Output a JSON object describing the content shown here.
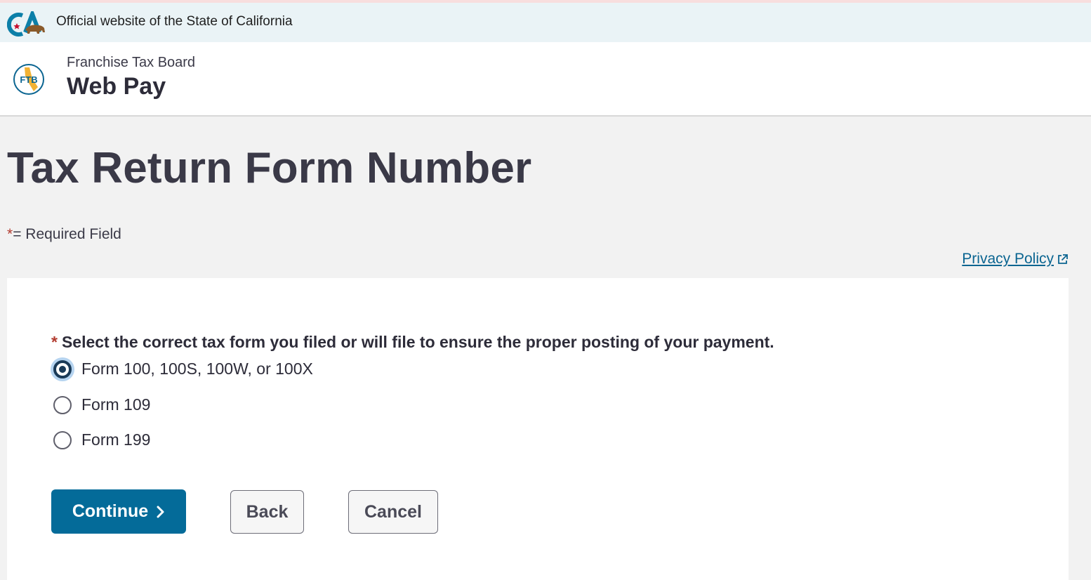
{
  "gov_banner": {
    "text": "Official website of the State of California",
    "logo_letters": "CA"
  },
  "header": {
    "agency": "Franchise Tax Board",
    "app_name": "Web Pay",
    "logo_letters": "FTB"
  },
  "page": {
    "title": "Tax Return Form Number",
    "required_star": "*",
    "required_note": "= Required Field",
    "privacy_link": "Privacy Policy"
  },
  "form": {
    "required_star": "*",
    "question": "Select the correct tax form you filed or will file to ensure the proper posting of your payment.",
    "options": [
      {
        "label": "Form 100, 100S, 100W, or 100X",
        "checked": true
      },
      {
        "label": "Form 109",
        "checked": false
      },
      {
        "label": "Form 199",
        "checked": false
      }
    ]
  },
  "buttons": {
    "continue": "Continue",
    "back": "Back",
    "cancel": "Cancel"
  },
  "colors": {
    "primary": "#046b99",
    "required": "#b23b2f",
    "link": "#0b6591",
    "gov_banner_bg": "#eaf3f6"
  }
}
